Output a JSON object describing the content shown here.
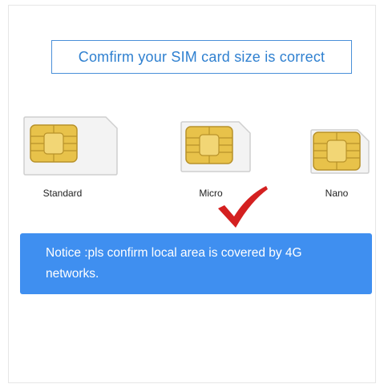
{
  "title": "Comfirm your SIM card size is correct",
  "cards": [
    {
      "label": "Standard",
      "icon": "sim-card-standard-icon"
    },
    {
      "label": "Micro",
      "icon": "sim-card-micro-icon",
      "selected": true
    },
    {
      "label": "Nano",
      "icon": "sim-card-nano-icon"
    }
  ],
  "selection_mark": "checkmark-icon",
  "notice": "Notice :pls confirm local area is covered by 4G networks.",
  "colors": {
    "accent_blue": "#2f80d0",
    "notice_bg": "#3f8ff0",
    "check_red": "#d42020",
    "chip_gold": "#e8c24a"
  }
}
